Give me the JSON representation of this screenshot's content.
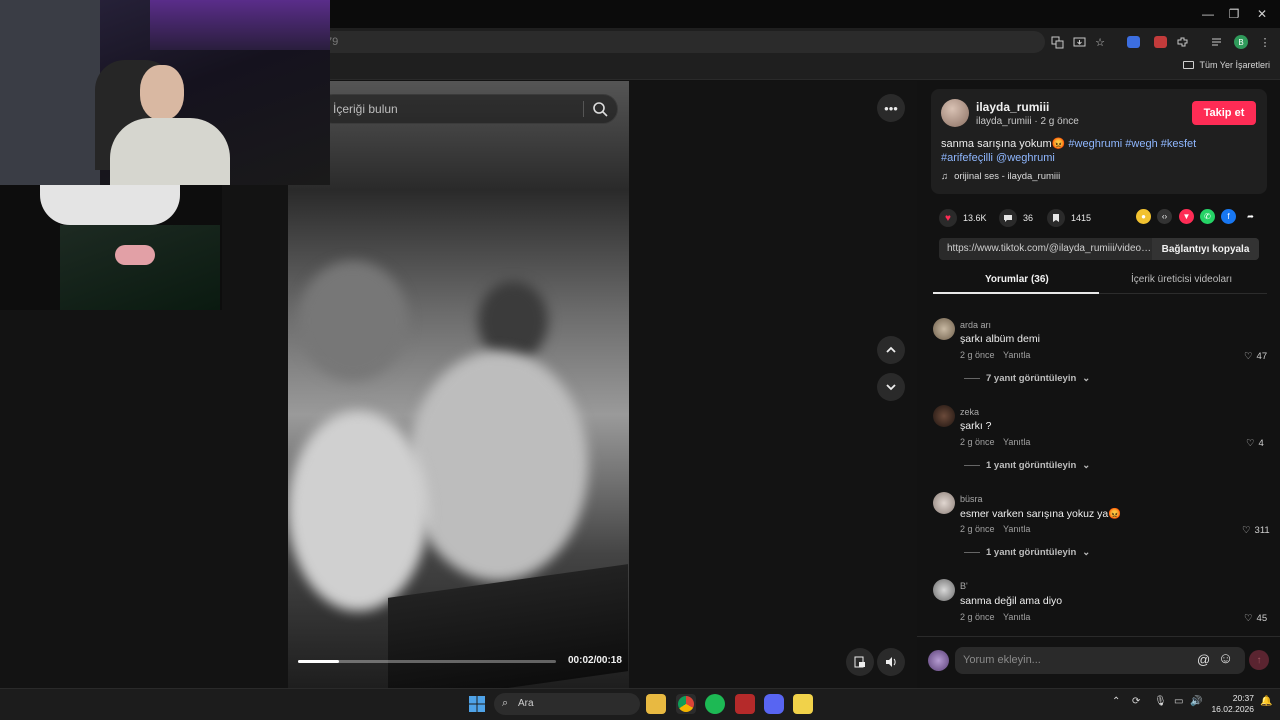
{
  "browser": {
    "url_fragment": "79",
    "bookmarks_label": "Tüm Yer İşaretleri",
    "window_controls": [
      "—",
      "❐",
      "✕"
    ],
    "profile_initial": "B"
  },
  "player": {
    "search_placeholder": "İçeriği bulun",
    "time_display": "00:02/00:18",
    "progress_fraction": 0.16,
    "more_icon": "more-dots-icon",
    "up_icon": "chevron-up-icon",
    "down_icon": "chevron-down-icon"
  },
  "post": {
    "username": "ilayda_rumiii",
    "handle_time": "ilayda_rumiii · 2 g önce",
    "follow_label": "Takip et",
    "caption_text": "sanma sarışına yokum😡 ",
    "hashtags_line1": "#weghrumi #wegh #kesfet",
    "hashtags_line2": "#arifefeçilli @weghrumi",
    "music": "orijinal ses - ilayda_rumiii",
    "likes": "13.6K",
    "comments": "36",
    "saves": "1415",
    "link": "https://www.tiktok.com/@ilayda_rumiii/video/...",
    "copy_label": "Bağlantıyı kopyala",
    "accent": "#fe2c55"
  },
  "tabs": {
    "comments_tab": "Yorumlar (36)",
    "creator_tab": "İçerik üreticisi videoları"
  },
  "comments": [
    {
      "name": "arda arı",
      "text": "şarkı albüm demi",
      "time": "2 g önce",
      "reply": "Yanıtla",
      "likes": "47",
      "replies": "7 yanıt görüntüleyin"
    },
    {
      "name": "zeka",
      "text": "şarkı ?",
      "time": "2 g önce",
      "reply": "Yanıtla",
      "likes": "4",
      "replies": "1 yanıt görüntüleyin"
    },
    {
      "name": "büsra",
      "text": "esmer varken sarışına yokuz ya😡",
      "time": "2 g önce",
      "reply": "Yanıtla",
      "likes": "311",
      "replies": "1 yanıt görüntüleyin"
    },
    {
      "name": "B'",
      "text": "sanma değil ama diyo",
      "time": "2 g önce",
      "reply": "Yanıtla",
      "likes": "45",
      "replies": ""
    }
  ],
  "composer": {
    "placeholder": "Yorum ekleyin...",
    "mention_icon": "@",
    "emoji_icon": "☺"
  },
  "taskbar": {
    "search_label": "Ara",
    "time": "20:37",
    "date": "16.02.2026"
  }
}
